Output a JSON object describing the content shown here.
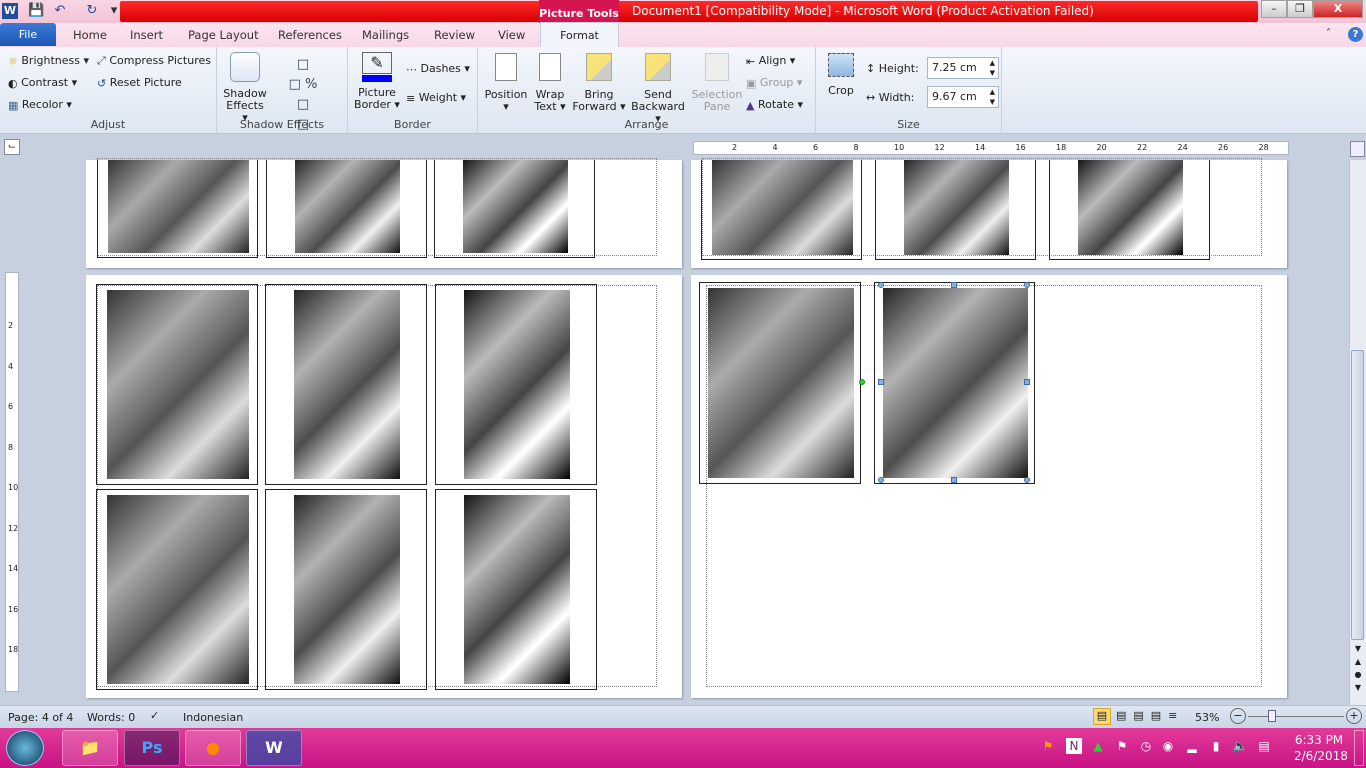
{
  "window": {
    "title": "Document1 [Compatibility Mode] - Microsoft Word (Product Activation Failed)",
    "context_tab": "Picture Tools"
  },
  "tabs": [
    "File",
    "Home",
    "Insert",
    "Page Layout",
    "References",
    "Mailings",
    "Review",
    "View",
    "Format"
  ],
  "ribbon": {
    "adjust": {
      "label": "Adjust",
      "brightness": "Brightness",
      "contrast": "Contrast",
      "recolor": "Recolor",
      "compress": "Compress Pictures",
      "reset": "Reset Picture"
    },
    "shadow": {
      "label": "Shadow Effects",
      "button": "Shadow Effects"
    },
    "border": {
      "label": "Border",
      "picture_border": "Picture Border",
      "dashes": "Dashes",
      "weight": "Weight",
      "border_color": "#0000ff"
    },
    "arrange": {
      "label": "Arrange",
      "position": "Position",
      "wrap": "Wrap Text",
      "bring": "Bring Forward",
      "send": "Send Backward",
      "selection": "Selection Pane",
      "align": "Align",
      "group": "Group",
      "rotate": "Rotate"
    },
    "size": {
      "label": "Size",
      "crop": "Crop",
      "height_label": "Height:",
      "height": "7.25 cm",
      "width_label": "Width:",
      "width": "9.67 cm"
    }
  },
  "ruler": {
    "h_ticks": [
      "2",
      "4",
      "6",
      "8",
      "10",
      "12",
      "14",
      "16",
      "18",
      "20",
      "22",
      "24",
      "26",
      "28"
    ],
    "v_ticks": [
      "2",
      "4",
      "6",
      "8",
      "10",
      "12",
      "14",
      "16",
      "18"
    ]
  },
  "status": {
    "page": "Page: 4 of 4",
    "words": "Words: 0",
    "language": "Indonesian",
    "zoom": "53%",
    "zoom_level": 53
  },
  "taskbar": {
    "time": "6:33 PM",
    "date": "2/6/2018",
    "apps": [
      "Explorer",
      "Photoshop",
      "Firefox",
      "Word"
    ]
  }
}
